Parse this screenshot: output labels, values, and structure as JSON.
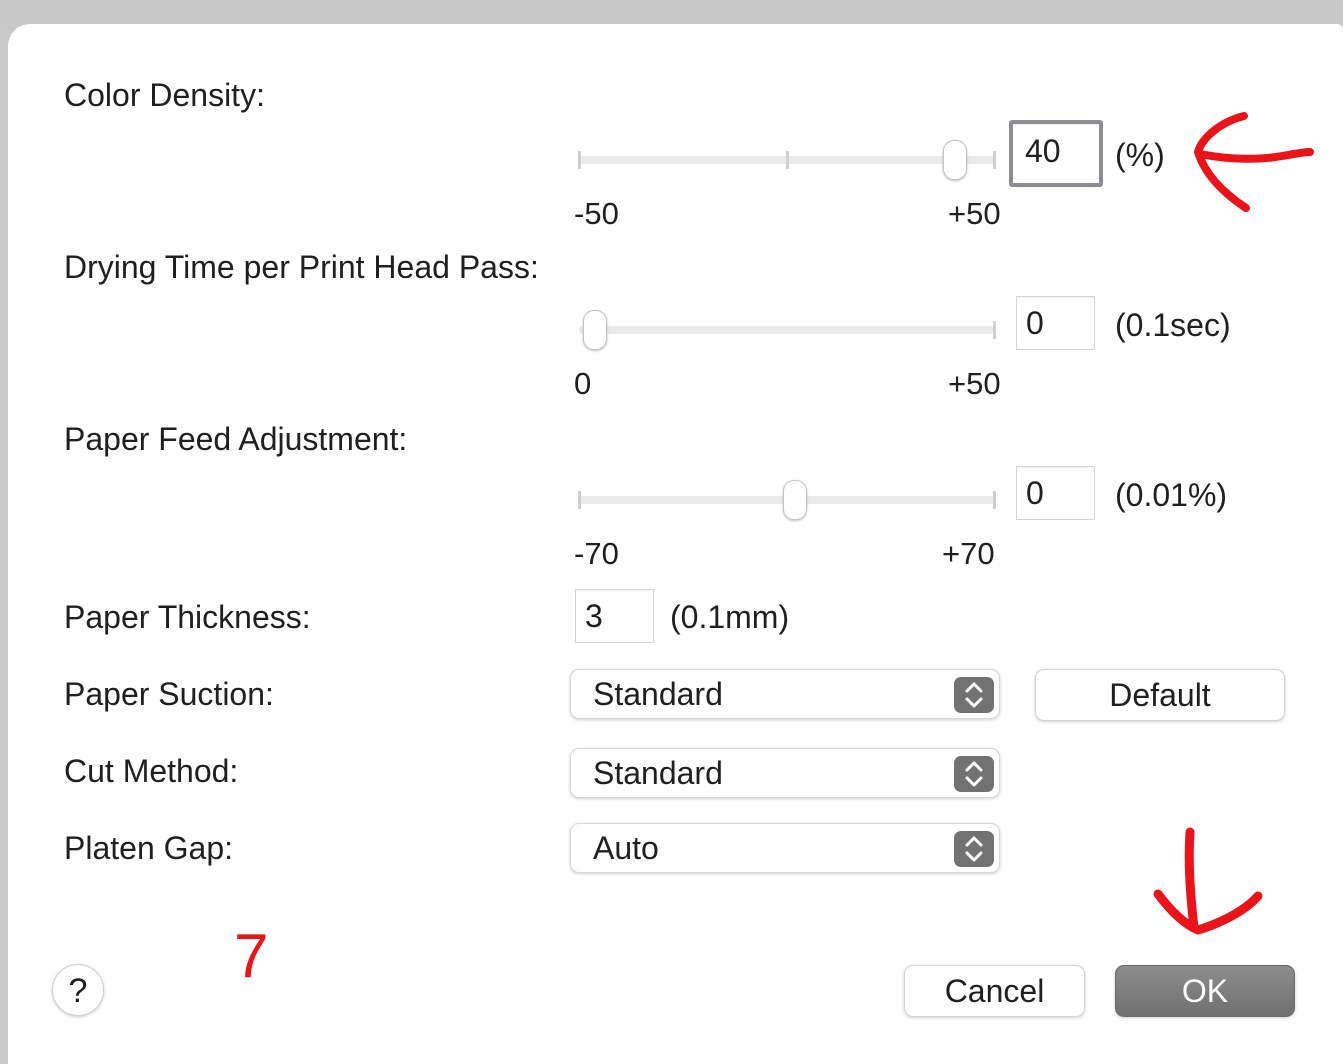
{
  "color_density": {
    "label": "Color Density:",
    "min_label": "-50",
    "max_label": "+50",
    "value": "40",
    "unit": "(%)",
    "slider_fraction": 0.9
  },
  "drying_time": {
    "label": "Drying Time per Print Head Pass:",
    "min_label": "0",
    "max_label": "+50",
    "value": "0",
    "unit": "(0.1sec)",
    "slider_fraction": 0.0
  },
  "paper_feed": {
    "label": "Paper Feed Adjustment:",
    "min_label": "-70",
    "max_label": "+70",
    "value": "0",
    "unit": "(0.01%)",
    "slider_fraction": 0.5
  },
  "paper_thickness": {
    "label": "Paper Thickness:",
    "value": "3",
    "unit": "(0.1mm)"
  },
  "paper_suction": {
    "label": "Paper Suction:",
    "value": "Standard"
  },
  "cut_method": {
    "label": "Cut Method:",
    "value": "Standard"
  },
  "platen_gap": {
    "label": "Platen Gap:",
    "value": "Auto"
  },
  "buttons": {
    "default": "Default",
    "cancel": "Cancel",
    "ok": "OK",
    "help": "?"
  },
  "annotations": {
    "step_number": "7",
    "color": "#e8141a"
  },
  "colors": {
    "primary_button": "#7a7a7a",
    "focus_ring": "#8e8e92"
  }
}
